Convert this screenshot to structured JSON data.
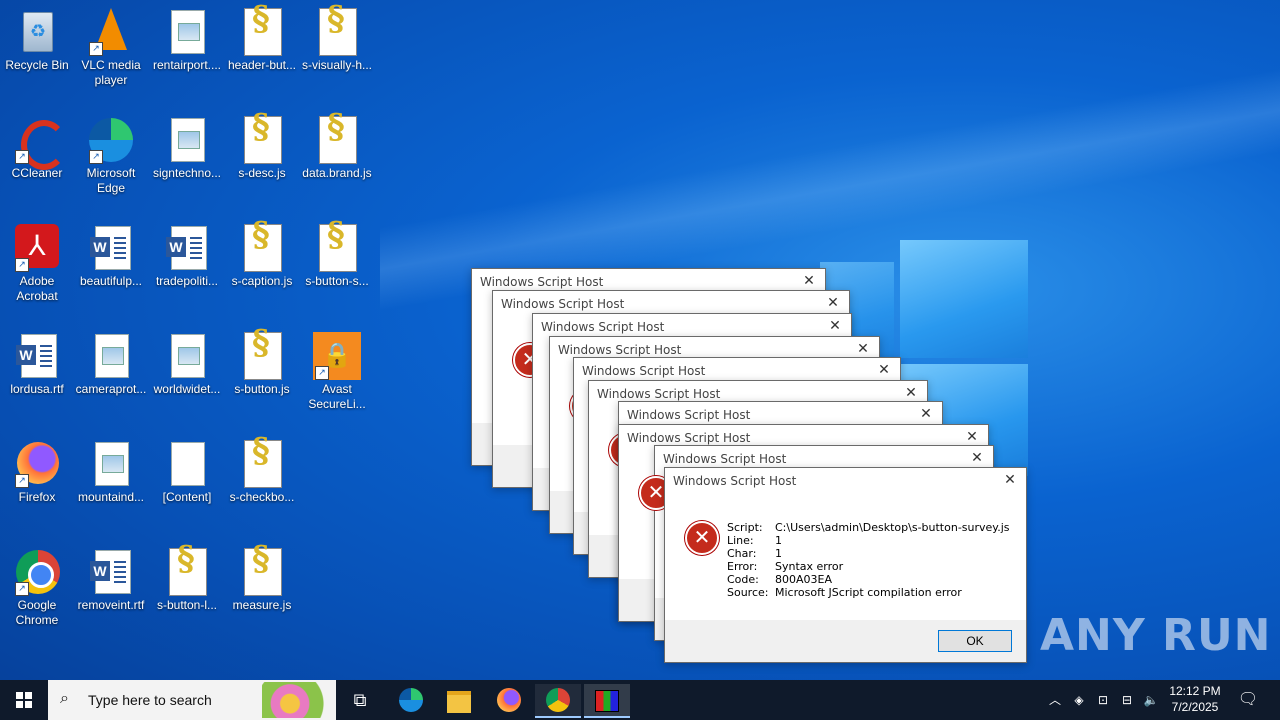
{
  "desktop": {
    "icons": [
      {
        "label": "Recycle Bin"
      },
      {
        "label": "VLC media player"
      },
      {
        "label": "rentairport...."
      },
      {
        "label": "header-but..."
      },
      {
        "label": "s-visually-h..."
      },
      {
        "label": "CCleaner"
      },
      {
        "label": "Microsoft Edge"
      },
      {
        "label": "signtechno..."
      },
      {
        "label": "s-desc.js"
      },
      {
        "label": "data.brand.js"
      },
      {
        "label": "Adobe Acrobat"
      },
      {
        "label": "beautifulp..."
      },
      {
        "label": "tradepoliti..."
      },
      {
        "label": "s-caption.js"
      },
      {
        "label": "s-button-s..."
      },
      {
        "label": "lordusa.rtf"
      },
      {
        "label": "cameraprot..."
      },
      {
        "label": "worldwidet..."
      },
      {
        "label": "s-button.js"
      },
      {
        "label": "Avast SecureLi..."
      },
      {
        "label": "Firefox"
      },
      {
        "label": "mountaind..."
      },
      {
        "label": "[Content]"
      },
      {
        "label": "s-checkbo..."
      },
      {
        "label": "Google Chrome"
      },
      {
        "label": "removeint.rtf"
      },
      {
        "label": "s-button-l..."
      },
      {
        "label": "measure.js"
      }
    ]
  },
  "dialogs": {
    "title": "Windows Script Host",
    "close_glyph": "✕",
    "front": {
      "title": "Windows Script Host",
      "script_key": "Script:",
      "script_val": "C:\\Users\\admin\\Desktop\\s-button-survey.js",
      "line_key": "Line:",
      "line_val": "1",
      "char_key": "Char:",
      "char_val": "1",
      "error_key": "Error:",
      "error_val": "Syntax error",
      "code_key": "Code:",
      "code_val": "800A03EA",
      "source_key": "Source:",
      "source_val": "Microsoft JScript compilation error",
      "ok_label": "OK"
    }
  },
  "taskbar": {
    "search_placeholder": "Type here to search",
    "time": "12:12 PM",
    "date": "7/2/2025"
  },
  "watermark": "ANY RUN",
  "colors": {
    "accent": "#0078d7",
    "error": "#c42b1c",
    "taskbar": "#0f1a2b"
  }
}
